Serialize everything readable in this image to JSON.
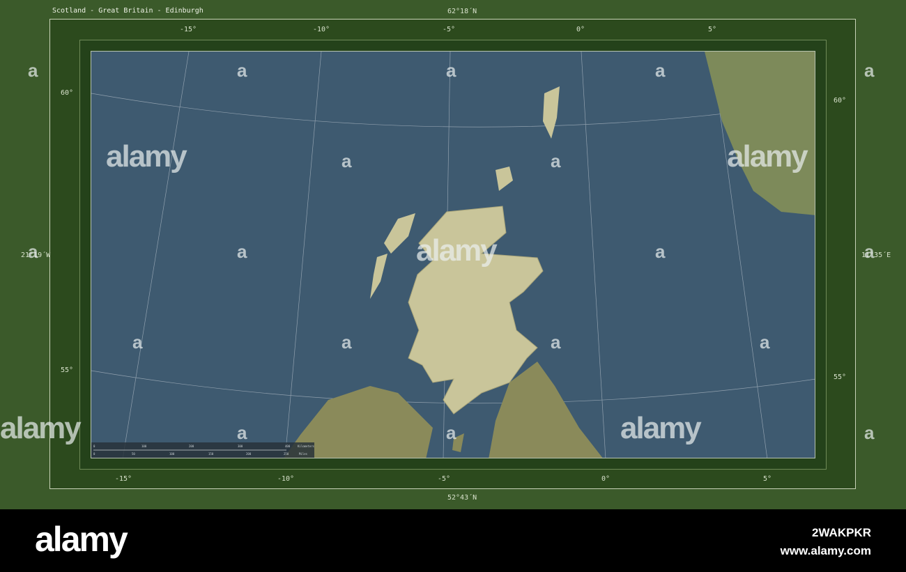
{
  "title": "Scotland - Great Britain - Edinburgh",
  "extent": {
    "north": "62°18´N",
    "south": "52°43´N",
    "west": "21°19´W",
    "east": "11°35´E"
  },
  "longitude_labels": [
    "-15°",
    "-10°",
    "-5°",
    "0°",
    "5°"
  ],
  "latitude_labels": [
    "60°",
    "55°"
  ],
  "scale_bar": {
    "km_ticks": [
      "0",
      "100",
      "200",
      "300",
      "400"
    ],
    "km_unit": "Kilometers",
    "mi_ticks": [
      "0",
      "50",
      "100",
      "150",
      "200",
      "250"
    ],
    "mi_unit": "Miles"
  },
  "colors": {
    "ocean": "#3e5a70",
    "frame": "#3b5a2a",
    "highlight_land": "#c9c59a",
    "other_land": "#8a8a5a"
  },
  "watermark": {
    "big": "alamy",
    "small": "a"
  },
  "footer": {
    "logo": "alamy",
    "image_id": "2WAKPKR",
    "url": "www.alamy.com"
  }
}
